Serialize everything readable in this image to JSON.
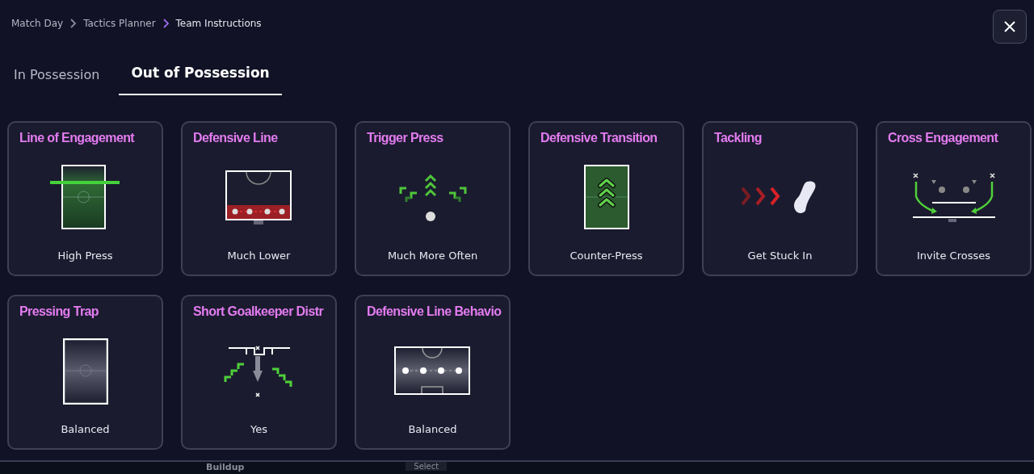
{
  "breadcrumb": [
    "Match Day",
    "Tactics Planner",
    "Team Instructions"
  ],
  "tabs": [
    {
      "label": "In Possession",
      "selected": false
    },
    {
      "label": "Out of Possession",
      "selected": true
    }
  ],
  "cards": [
    {
      "title": "Line of Engagement",
      "value": "High Press",
      "kind": "engagement"
    },
    {
      "title": "Defensive Line",
      "value": "Much Lower",
      "kind": "line"
    },
    {
      "title": "Trigger Press",
      "value": "Much More Often",
      "kind": "trigger"
    },
    {
      "title": "Defensive Transition",
      "value": "Counter-Press",
      "kind": "transition"
    },
    {
      "title": "Tackling",
      "value": "Get Stuck In",
      "kind": "tackling"
    },
    {
      "title": "Cross Engagement",
      "value": "Invite Crosses",
      "kind": "cross"
    },
    {
      "title": "Pressing Trap",
      "value": "Balanced",
      "kind": "trap"
    },
    {
      "title": "Short Goalkeeper Distr",
      "value": "Yes",
      "kind": "goalkeeper"
    },
    {
      "title": "Defensive Line Behavio",
      "value": "Balanced",
      "kind": "behaviour"
    }
  ],
  "background": {
    "section": "Buildup",
    "button": "Select"
  }
}
